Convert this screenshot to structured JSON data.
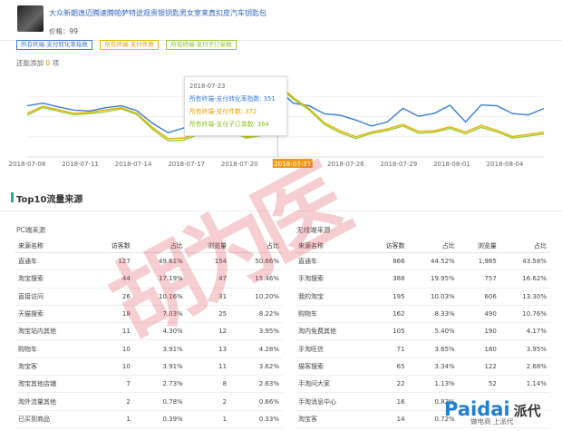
{
  "product": {
    "title": "大众新朗逸迈腾速腾帕萨特途观贵银钥匙男女室来真扣皮汽车钥匙包",
    "price": "价格：99"
  },
  "legend": {
    "items": [
      {
        "label": "所有终端-支付转化率指数",
        "color": "#3a7bd5"
      },
      {
        "label": "所有终端-支付件数",
        "color": "#f0b400"
      },
      {
        "label": "所有终端-支付子订单数",
        "color": "#9acd32"
      }
    ],
    "added_prefix": "还能添加",
    "added_count": "0",
    "added_suffix": "项"
  },
  "tooltip": {
    "date": "2018-07-23",
    "rows": [
      {
        "label": "所有终端-支付转化率指数: 351",
        "color": "#3a7bd5"
      },
      {
        "label": "所有终端-支付件数: 372",
        "color": "#f0a000"
      },
      {
        "label": "所有终端-支付子订单数: 364",
        "color": "#8cbf26"
      }
    ]
  },
  "chart_data": {
    "type": "line",
    "x_ticks": [
      "2018-07-08",
      "2018-07-11",
      "2018-07-14",
      "2018-07-17",
      "2018-07-20",
      "2018-07-23",
      "2018-07-26",
      "2018-07-29",
      "2018-08-01",
      "2018-08-04"
    ],
    "highlight_tick": "2018-07-23",
    "ylim": [
      100,
      400
    ],
    "series": [
      {
        "name": "所有终端-支付转化率指数",
        "color": "#3a7bd5",
        "values": [
          290,
          300,
          286,
          274,
          271,
          283,
          290,
          272,
          225,
          190,
          208,
          243,
          251,
          238,
          220,
          255,
          351,
          300,
          290,
          260,
          255,
          237,
          215,
          230,
          281,
          251,
          262,
          292,
          230,
          293,
          290,
          261,
          256,
          280
        ]
      },
      {
        "name": "所有终端-支付件数",
        "color": "#e8b000",
        "values": [
          262,
          288,
          276,
          262,
          266,
          275,
          283,
          262,
          210,
          168,
          170,
          192,
          226,
          202,
          175,
          186,
          372,
          320,
          280,
          226,
          197,
          175,
          193,
          204,
          221,
          195,
          197,
          212,
          193,
          217,
          199,
          176,
          184,
          192
        ]
      },
      {
        "name": "所有终端-支付子订单数",
        "color": "#9acd32",
        "values": [
          255,
          284,
          270,
          257,
          261,
          268,
          279,
          258,
          203,
          160,
          163,
          185,
          221,
          195,
          170,
          180,
          364,
          315,
          275,
          220,
          190,
          168,
          188,
          198,
          215,
          188,
          192,
          206,
          186,
          210,
          193,
          170,
          178,
          186
        ]
      }
    ]
  },
  "section": {
    "title": "Top10流量来源"
  },
  "pc": {
    "title": "PC端来源",
    "headers": [
      "来源名称",
      "访客数",
      "占比",
      "浏览量",
      "占比"
    ],
    "rows": [
      [
        "直通车",
        "127",
        "49.61%",
        "154",
        "50.66%"
      ],
      [
        "淘宝搜索",
        "44",
        "17.19%",
        "47",
        "15.46%"
      ],
      [
        "直接访问",
        "26",
        "10.16%",
        "31",
        "10.20%"
      ],
      [
        "天猫搜索",
        "18",
        "7.03%",
        "25",
        "8.22%"
      ],
      [
        "淘宝站内其他",
        "11",
        "4.30%",
        "12",
        "3.95%"
      ],
      [
        "购物车",
        "10",
        "3.91%",
        "13",
        "4.28%"
      ],
      [
        "淘宝客",
        "10",
        "3.91%",
        "11",
        "3.62%"
      ],
      [
        "淘宝其他店铺",
        "7",
        "2.73%",
        "8",
        "2.63%"
      ],
      [
        "淘外流量其他",
        "2",
        "0.78%",
        "2",
        "0.66%"
      ],
      [
        "已买到商品",
        "1",
        "0.39%",
        "1",
        "0.33%"
      ]
    ]
  },
  "mobile": {
    "title": "无线端来源",
    "headers": [
      "来源名称",
      "访客数",
      "占比",
      "浏览量",
      "占比"
    ],
    "rows": [
      [
        "直通车",
        "866",
        "44.52%",
        "1,985",
        "43.58%"
      ],
      [
        "手淘搜索",
        "388",
        "19.95%",
        "757",
        "16.62%"
      ],
      [
        "我的淘宝",
        "195",
        "10.03%",
        "606",
        "13.30%"
      ],
      [
        "购物车",
        "162",
        "8.33%",
        "490",
        "10.76%"
      ],
      [
        "淘内免费其他",
        "105",
        "5.40%",
        "190",
        "4.17%"
      ],
      [
        "手淘旺信",
        "71",
        "3.65%",
        "180",
        "3.95%"
      ],
      [
        "猫客搜索",
        "65",
        "3.34%",
        "122",
        "2.68%"
      ],
      [
        "手淘问大家",
        "22",
        "1.13%",
        "52",
        "1.14%"
      ],
      [
        "手淘消息中心",
        "16",
        "0.82%",
        "",
        ""
      ],
      [
        "淘宝客",
        "14",
        "0.72%",
        "",
        ""
      ]
    ]
  },
  "watermark": {
    "stamp": "胡为医"
  },
  "logo": {
    "brand": "Paidai",
    "cn": "派代",
    "sub": "做电商 上派代"
  }
}
